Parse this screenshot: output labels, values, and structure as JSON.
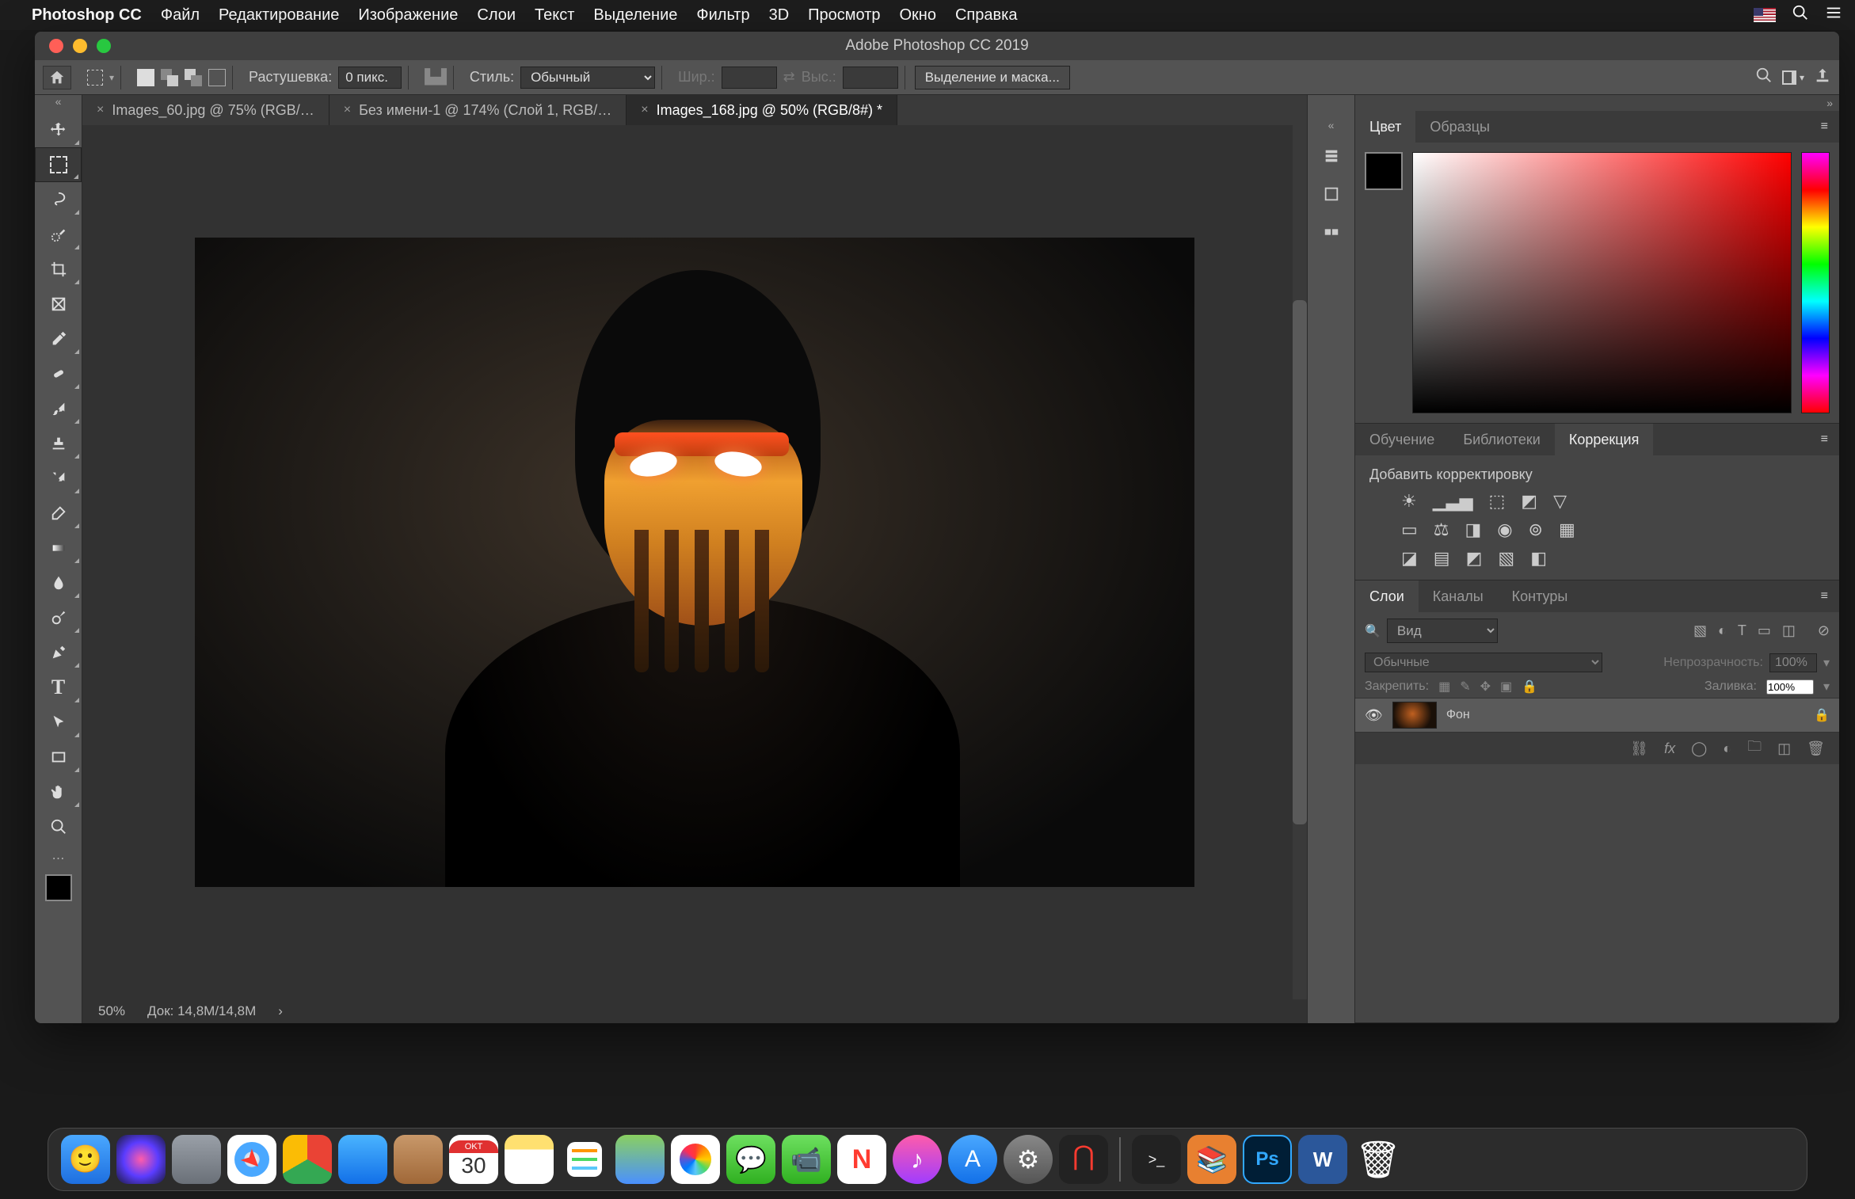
{
  "macos_menu": {
    "app": "Photoshop CC",
    "items": [
      "Файл",
      "Редактирование",
      "Изображение",
      "Слои",
      "Текст",
      "Выделение",
      "Фильтр",
      "3D",
      "Просмотр",
      "Окно",
      "Справка"
    ]
  },
  "window_title": "Adobe Photoshop CC 2019",
  "options": {
    "feather_label": "Растушевка:",
    "feather_value": "0 пикс.",
    "style_label": "Стиль:",
    "style_value": "Обычный",
    "width_label": "Шир.:",
    "height_label": "Выс.:",
    "select_mask": "Выделение и маска..."
  },
  "doc_tabs": [
    {
      "label": "Images_60.jpg @ 75% (RGB/…",
      "active": false
    },
    {
      "label": "Без имени-1 @ 174% (Слой 1, RGB/…",
      "active": false
    },
    {
      "label": "Images_168.jpg @ 50% (RGB/8#) *",
      "active": true
    }
  ],
  "status": {
    "zoom": "50%",
    "doc": "Док: 14,8M/14,8M"
  },
  "panels": {
    "color_tabs": [
      "Цвет",
      "Образцы"
    ],
    "learn_tabs": [
      "Обучение",
      "Библиотеки",
      "Коррекция"
    ],
    "adjust_label": "Добавить корректировку",
    "layer_tabs": [
      "Слои",
      "Каналы",
      "Контуры"
    ],
    "layer_kind": "Вид",
    "blend_mode": "Обычные",
    "opacity_label": "Непрозрачность:",
    "opacity_value": "100%",
    "lock_label": "Закрепить:",
    "fill_label": "Заливка:",
    "fill_value": "100%",
    "layer_name": "Фон"
  },
  "tool_names": [
    "move",
    "marquee",
    "lasso",
    "quick-select",
    "crop",
    "frame",
    "eyedropper",
    "healing",
    "brush",
    "stamp",
    "history-brush",
    "eraser",
    "gradient",
    "blur",
    "dodge",
    "pen",
    "type",
    "path-select",
    "rectangle",
    "hand",
    "zoom"
  ],
  "dock_apps": [
    {
      "name": "finder",
      "bg": "linear-gradient(#4aa8ff,#1e6fe0)"
    },
    {
      "name": "siri",
      "bg": "radial-gradient(circle,#ff5caa 0%,#5a3cff 50%,#1a1a3a 100%)"
    },
    {
      "name": "launchpad",
      "bg": "linear-gradient(#9aa0a8,#6a7078)"
    },
    {
      "name": "safari",
      "bg": "linear-gradient(#4aa8ff,#0060d0)"
    },
    {
      "name": "chrome",
      "bg": "conic-gradient(#ea4335 0 120deg,#34a853 120deg 240deg,#fbbc05 240deg 360deg)"
    },
    {
      "name": "mail",
      "bg": "linear-gradient(#4ab4ff,#1270e8)"
    },
    {
      "name": "contacts",
      "bg": "linear-gradient(#c8986a,#a06838)"
    },
    {
      "name": "calendar",
      "bg": "#fff",
      "text": "30",
      "top": "OKT"
    },
    {
      "name": "notes",
      "bg": "linear-gradient(#ffe070 0 30%,#fff 30%)"
    },
    {
      "name": "reminders",
      "bg": "#fff"
    },
    {
      "name": "maps",
      "bg": "linear-gradient(#8ad060,#4a90ff)"
    },
    {
      "name": "photos",
      "bg": "#fff"
    },
    {
      "name": "messages",
      "bg": "linear-gradient(#6ee060,#30b020)"
    },
    {
      "name": "facetime",
      "bg": "linear-gradient(#6ee060,#30b020)"
    },
    {
      "name": "news",
      "bg": "#fff"
    },
    {
      "name": "itunes",
      "bg": "linear-gradient(#ff5caa,#a03cff)"
    },
    {
      "name": "appstore",
      "bg": "linear-gradient(#4aa8ff,#1270e8)"
    },
    {
      "name": "settings",
      "bg": "linear-gradient(#888,#555)"
    },
    {
      "name": "magnet",
      "bg": "#222"
    },
    {
      "name": "terminal",
      "bg": "#222"
    },
    {
      "name": "books",
      "bg": "#e88030"
    },
    {
      "name": "photoshop",
      "bg": "#001e36"
    },
    {
      "name": "word",
      "bg": "#2b579a"
    },
    {
      "name": "trash",
      "bg": "linear-gradient(#aab,#778)"
    }
  ]
}
